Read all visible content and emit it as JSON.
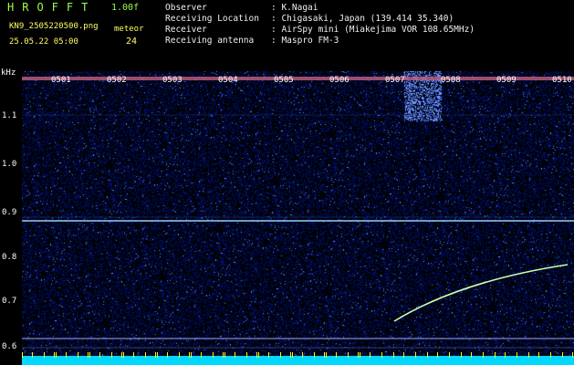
{
  "header": {
    "app_name": "HROFFT",
    "version": "1.00f",
    "filename": "KN9_2505220500.png",
    "datetime": "25.05.22 05:00",
    "meteor_label": "meteor",
    "meteor_count": "24"
  },
  "info": [
    {
      "key": "Observer",
      "value": ": K.Nagai"
    },
    {
      "key": "Receiving Location",
      "value": ": Chigasaki, Japan (139.414 35.340)"
    },
    {
      "key": "Receiver",
      "value": ": AirSpy mini (Miakejima VOR 108.65MHz)"
    },
    {
      "key": "Receiving antenna",
      "value": ": Maspro FM-3"
    }
  ],
  "axis": {
    "unit": "kHz",
    "y_ticks": [
      "1.1",
      "1.0",
      "0.9",
      "0.8",
      "0.7",
      "0.6"
    ],
    "x_ticks": [
      "0501",
      "0502",
      "0503",
      "0504",
      "0505",
      "0506",
      "0507",
      "0508",
      "0509",
      "0510"
    ]
  },
  "colors": {
    "background": "#000000",
    "title_green": "#9cff4a",
    "meta_yellow": "#ffff66",
    "spectrogram_noise": "#1a2bff",
    "carrier_line": "#8fd0ff",
    "meteor_trace": "#c8ffb0",
    "bottom_bar": "#00d8ff",
    "tick_marker": "#ffff00"
  }
}
